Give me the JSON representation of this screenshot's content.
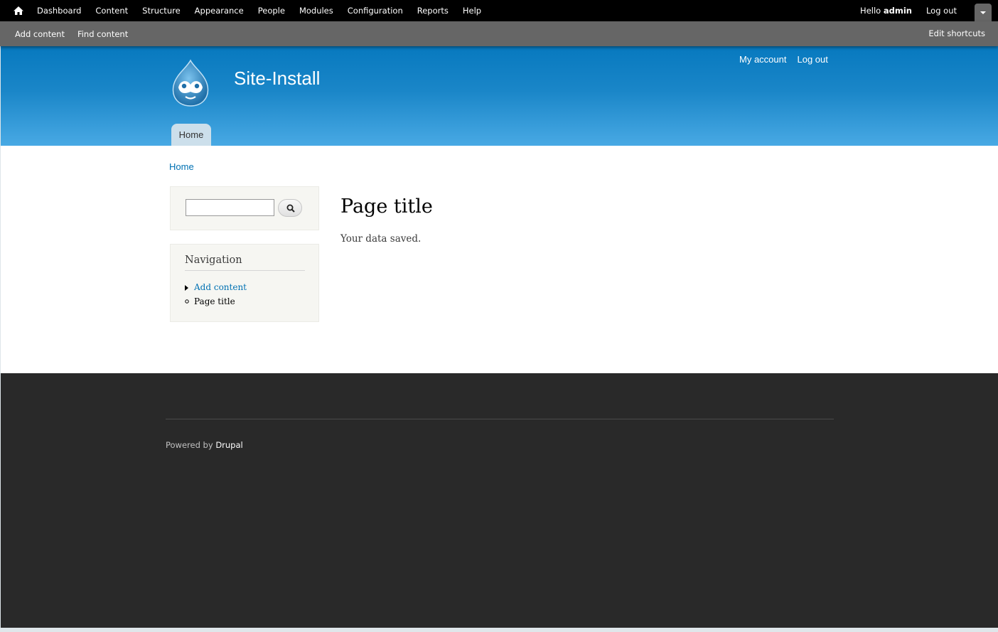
{
  "toolbar": {
    "home_icon": "home-icon",
    "menu": [
      "Dashboard",
      "Content",
      "Structure",
      "Appearance",
      "People",
      "Modules",
      "Configuration",
      "Reports",
      "Help"
    ],
    "hello": "Hello",
    "username": "admin",
    "logout": "Log out",
    "toggle_icon": "chevron-down-icon"
  },
  "shortcuts": {
    "items": [
      "Add content",
      "Find content"
    ],
    "edit": "Edit shortcuts"
  },
  "header": {
    "site_name": "Site-Install",
    "logo_icon": "drupal-drop-logo",
    "secondary": [
      "My account",
      "Log out"
    ],
    "main_tab": "Home"
  },
  "main": {
    "breadcrumb": "Home",
    "search": {
      "placeholder": "",
      "button_icon": "search-icon"
    },
    "navigation": {
      "title": "Navigation",
      "items": [
        "Add content",
        "Page title"
      ]
    },
    "title": "Page title",
    "text": "Your data saved."
  },
  "footer": {
    "powered_prefix": "Powered by",
    "powered_link": "Drupal"
  },
  "colors": {
    "link": "#0071b3",
    "header_top": "#0779bf",
    "header_bottom": "#48a9e4",
    "footer_bg": "#292929"
  }
}
